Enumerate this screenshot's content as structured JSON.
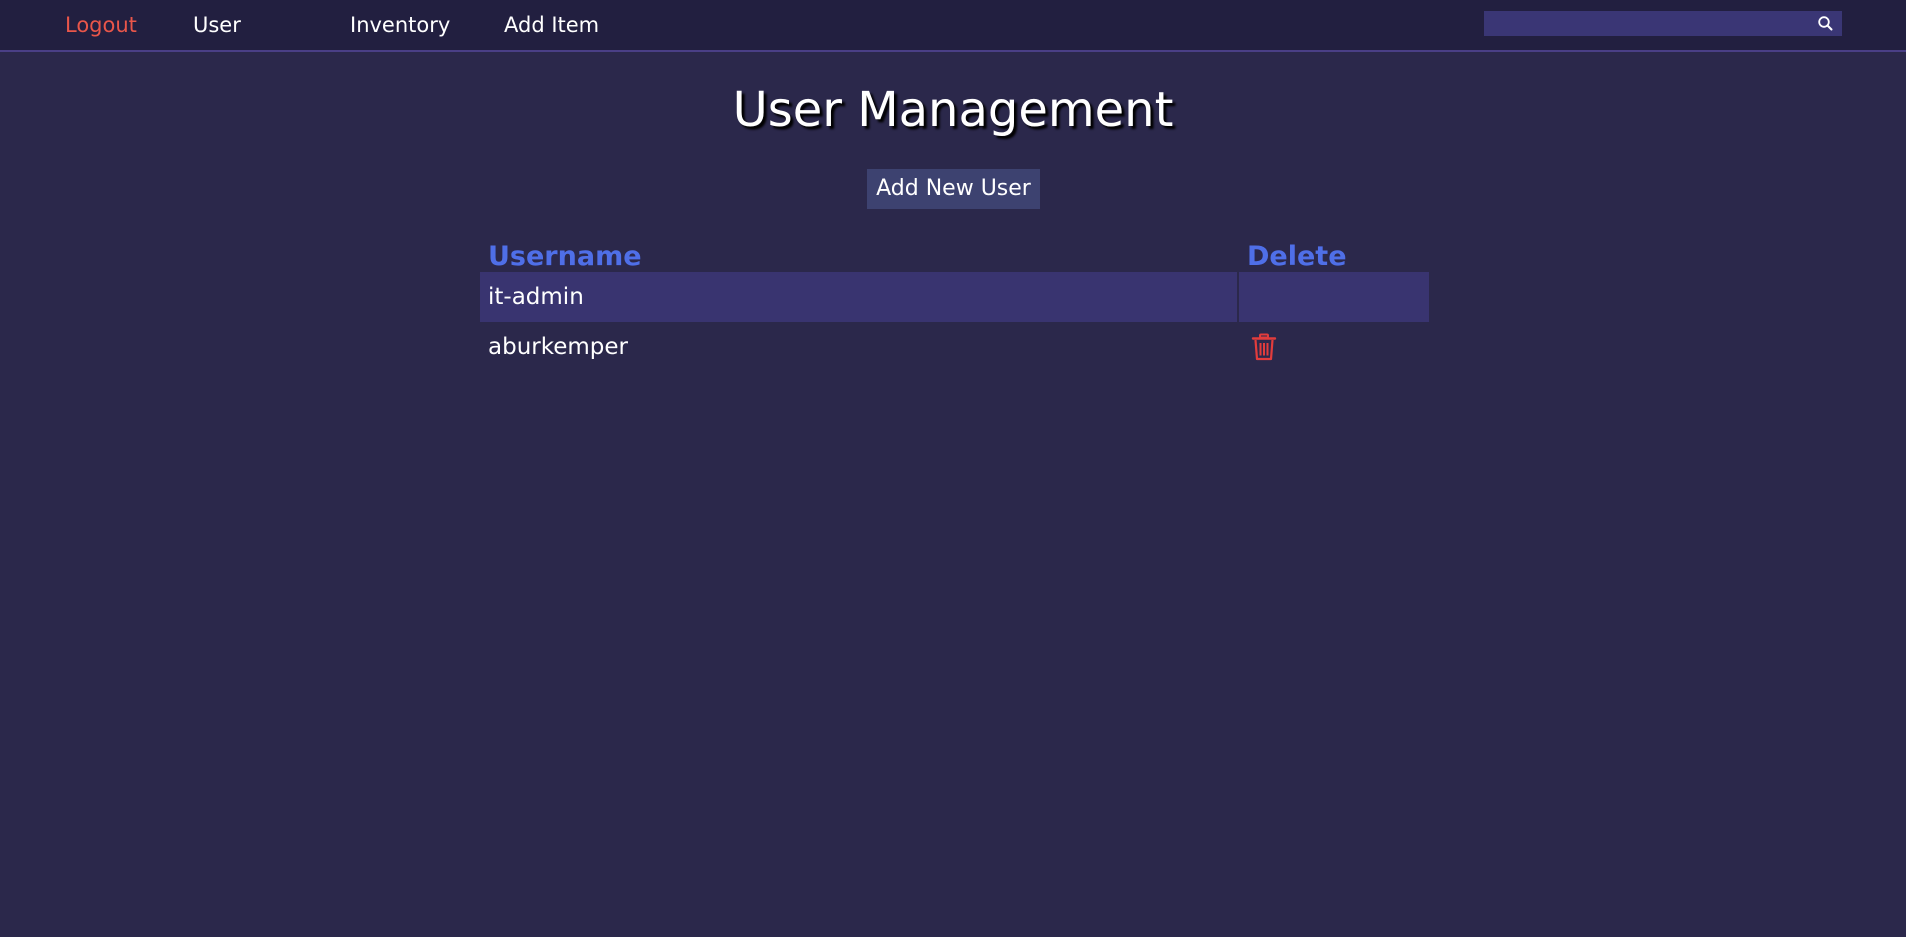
{
  "nav": {
    "logout_label": "Logout",
    "user_label": "User",
    "inventory_label": "Inventory",
    "add_item_label": "Add Item"
  },
  "search": {
    "value": "",
    "placeholder": "",
    "icon": "search-icon"
  },
  "page": {
    "title": "User Management",
    "add_user_label": "Add New User"
  },
  "table": {
    "columns": [
      "Username",
      "Delete"
    ],
    "rows": [
      {
        "username": "it-admin",
        "delete_icon": "",
        "highlighted": true
      },
      {
        "username": "aburkemper",
        "delete_icon": "trash-icon",
        "highlighted": false
      }
    ]
  },
  "colors": {
    "background": "#2b284b",
    "topbar": "#221f40",
    "logout": "#e9564a",
    "header_text": "#4f6fe8",
    "row_highlight": "#393470",
    "button": "#3d4270",
    "trash": "#e23c3c"
  }
}
